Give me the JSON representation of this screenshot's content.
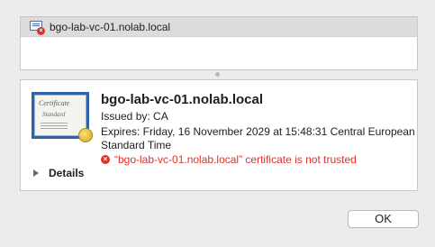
{
  "certificate_list": {
    "items": [
      {
        "label": "bgo-lab-vc-01.nolab.local",
        "icon": "certificate-error-icon"
      }
    ]
  },
  "certificate_detail": {
    "icon": "certificate-icon",
    "icon_text": {
      "title": "Certificate",
      "subtitle": "Standard"
    },
    "title": "bgo-lab-vc-01.nolab.local",
    "issued_by": "Issued by: CA",
    "expires_line1": "Expires: Friday, 16 November 2029 at 15:48:31 Central European",
    "expires_line2": "Standard Time",
    "error_message": "“bgo-lab-vc-01.nolab.local” certificate is not trusted",
    "error_color": "#e0302a"
  },
  "details_toggle": {
    "label": "Details",
    "expanded": false
  },
  "buttons": {
    "ok": "OK"
  }
}
